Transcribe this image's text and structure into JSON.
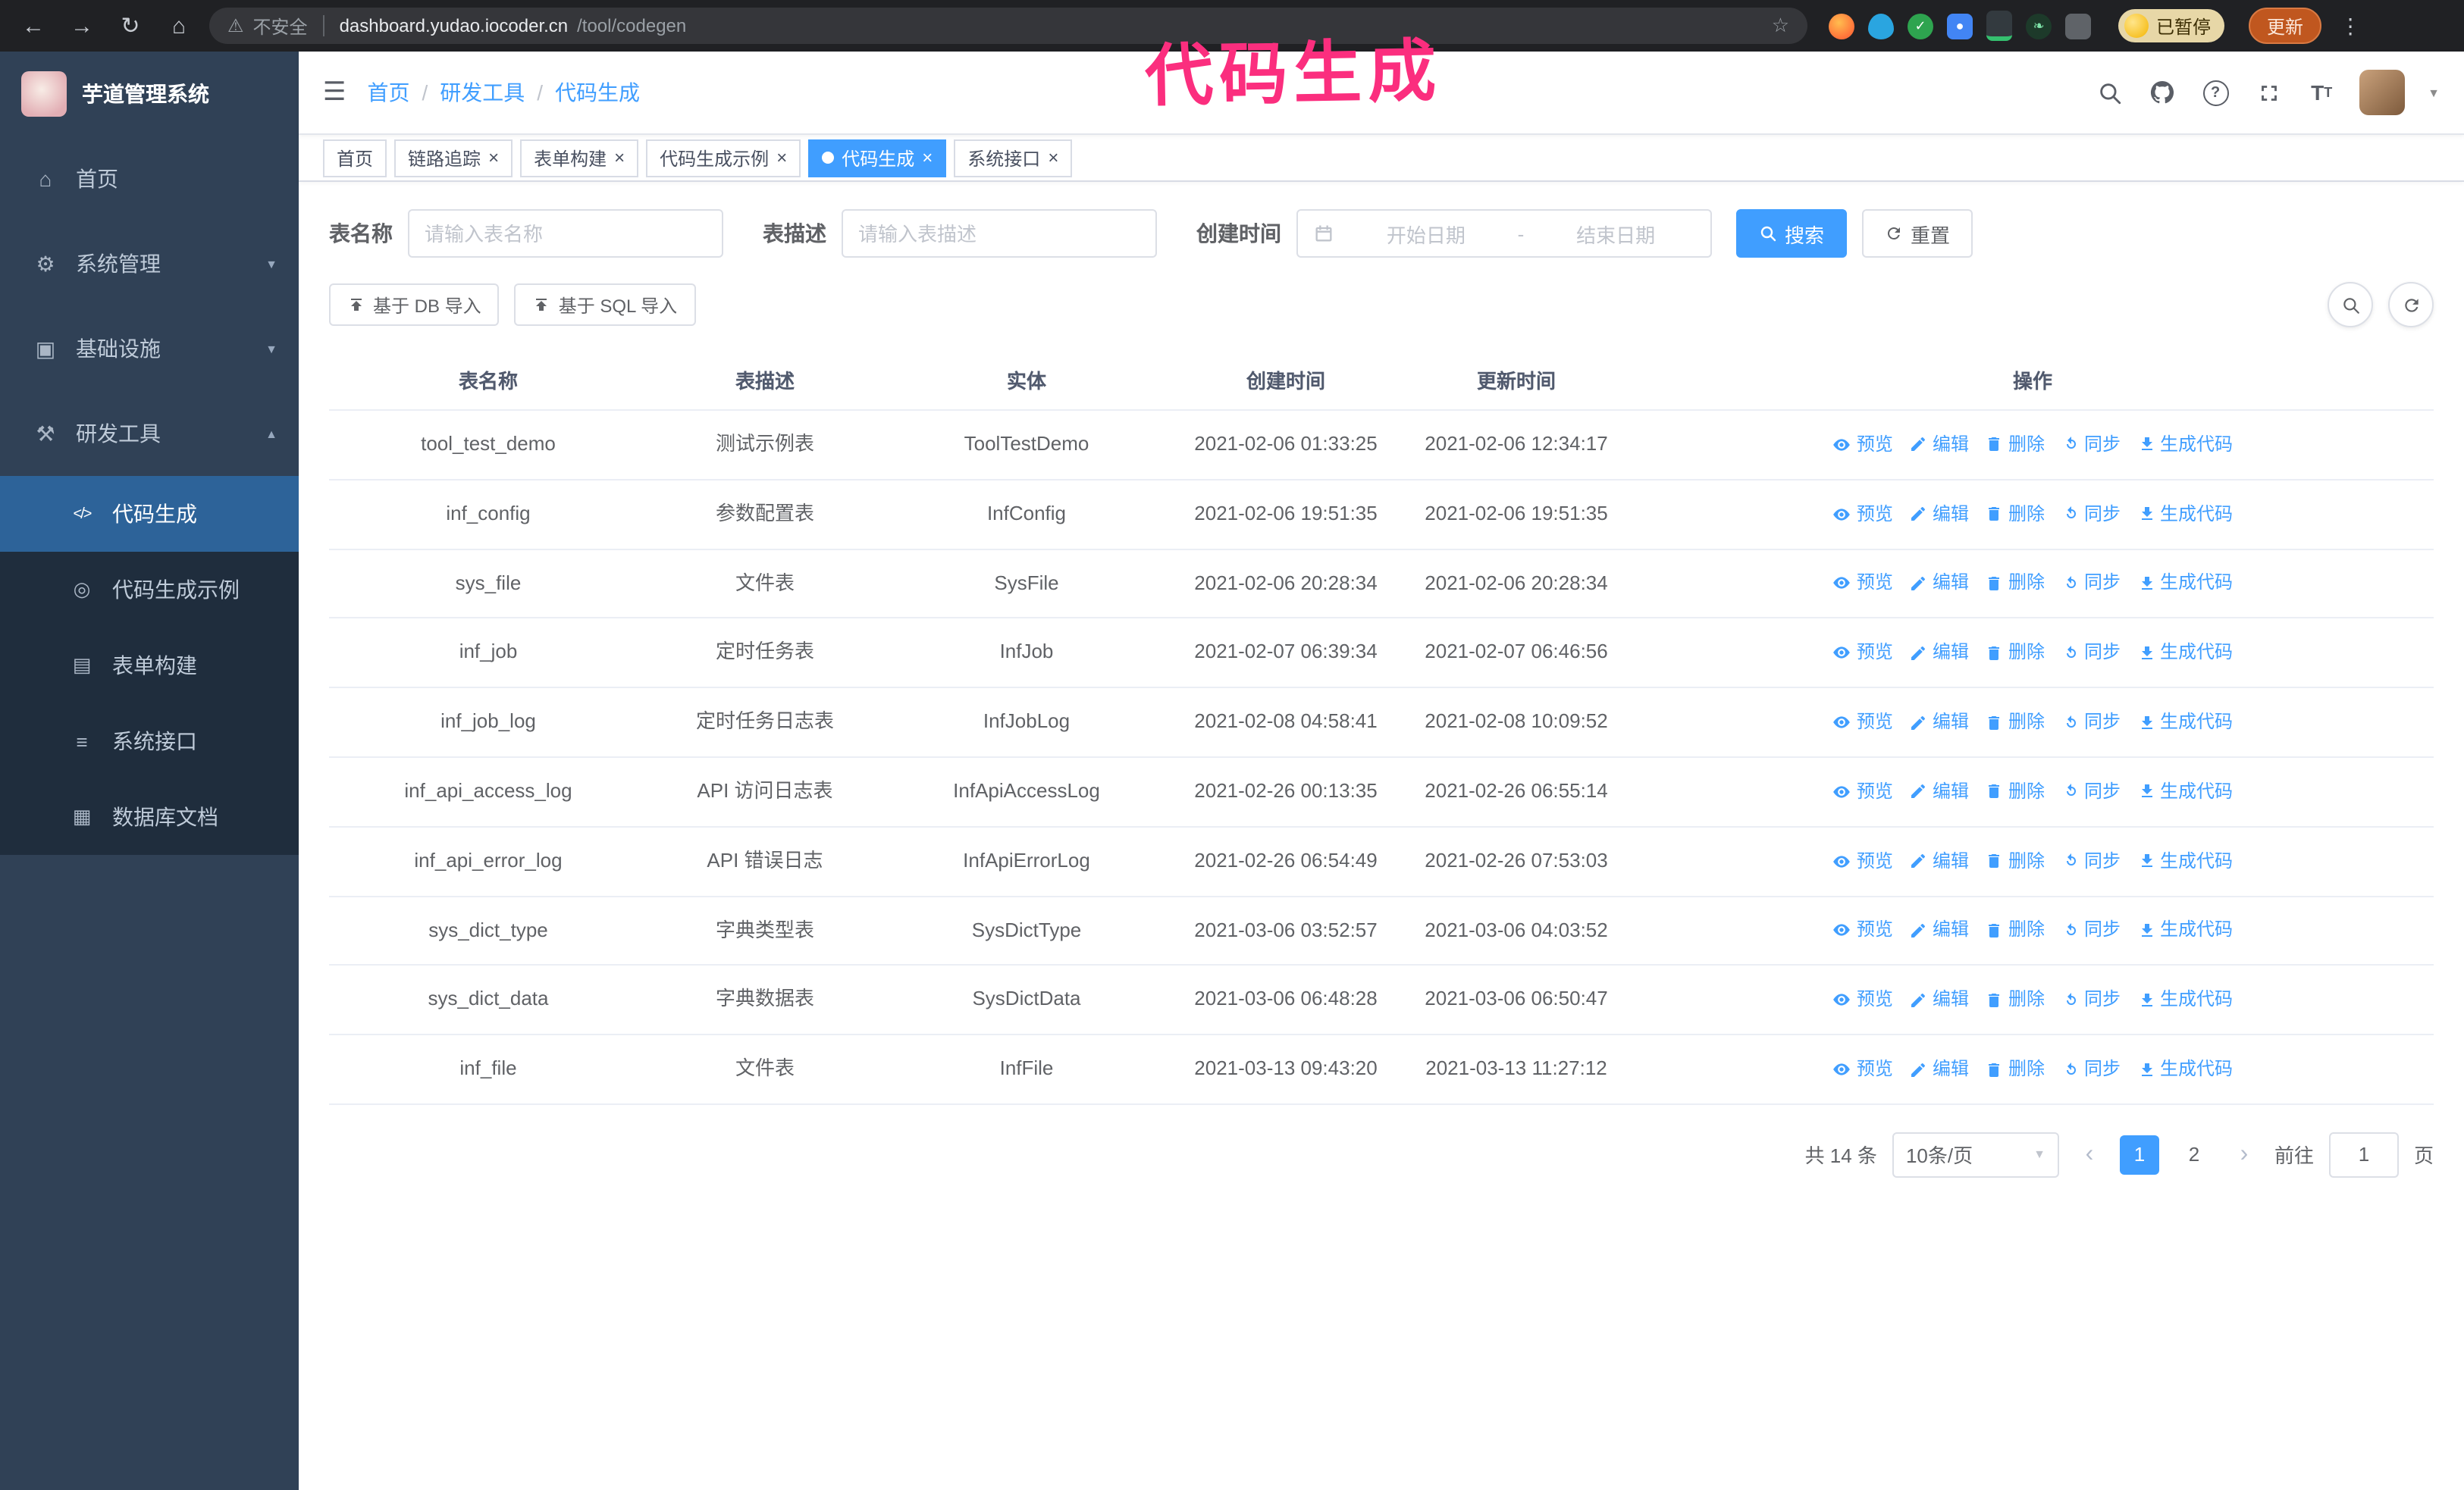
{
  "browser": {
    "security_label": "不安全",
    "url_host": "dashboard.yudao.iocoder.cn",
    "url_path": "/tool/codegen",
    "paused_badge": "已暂停",
    "update_button": "更新"
  },
  "annotation": {
    "text": "代码生成",
    "color": "#fb2e7e"
  },
  "sidebar": {
    "logo_title": "芋道管理系统",
    "items": [
      {
        "label": "首页",
        "icon": "home-icon"
      },
      {
        "label": "系统管理",
        "icon": "gear-icon"
      },
      {
        "label": "基础设施",
        "icon": "infrastructure-icon"
      },
      {
        "label": "研发工具",
        "icon": "tools-icon"
      }
    ],
    "submenu": [
      {
        "label": "代码生成",
        "icon": "code-icon",
        "active": true
      },
      {
        "label": "代码生成示例",
        "icon": "example-icon"
      },
      {
        "label": "表单构建",
        "icon": "form-icon"
      },
      {
        "label": "系统接口",
        "icon": "api-icon"
      },
      {
        "label": "数据库文档",
        "icon": "db-doc-icon"
      }
    ]
  },
  "header": {
    "breadcrumb": [
      "首页",
      "研发工具",
      "代码生成"
    ]
  },
  "tabs": [
    {
      "label": "首页",
      "closable": false
    },
    {
      "label": "链路追踪",
      "closable": true
    },
    {
      "label": "表单构建",
      "closable": true
    },
    {
      "label": "代码生成示例",
      "closable": true
    },
    {
      "label": "代码生成",
      "closable": true,
      "active": true
    },
    {
      "label": "系统接口",
      "closable": true
    }
  ],
  "filters": {
    "table_name_label": "表名称",
    "table_name_placeholder": "请输入表名称",
    "table_desc_label": "表描述",
    "table_desc_placeholder": "请输入表描述",
    "create_time_label": "创建时间",
    "date_start_placeholder": "开始日期",
    "date_separator": "-",
    "date_end_placeholder": "结束日期",
    "search_button": "搜索",
    "reset_button": "重置"
  },
  "toolbar": {
    "import_db_button": "基于 DB 导入",
    "import_sql_button": "基于 SQL 导入"
  },
  "table": {
    "columns": [
      "表名称",
      "表描述",
      "实体",
      "创建时间",
      "更新时间",
      "操作"
    ],
    "actions": [
      "预览",
      "编辑",
      "删除",
      "同步",
      "生成代码"
    ],
    "rows": [
      {
        "name": "tool_test_demo",
        "desc": "测试示例表",
        "entity": "ToolTestDemo",
        "created": "2021-02-06 01:33:25",
        "updated": "2021-02-06 12:34:17"
      },
      {
        "name": "inf_config",
        "desc": "参数配置表",
        "entity": "InfConfig",
        "created": "2021-02-06 19:51:35",
        "updated": "2021-02-06 19:51:35"
      },
      {
        "name": "sys_file",
        "desc": "文件表",
        "entity": "SysFile",
        "created": "2021-02-06 20:28:34",
        "updated": "2021-02-06 20:28:34"
      },
      {
        "name": "inf_job",
        "desc": "定时任务表",
        "entity": "InfJob",
        "created": "2021-02-07 06:39:34",
        "updated": "2021-02-07 06:46:56"
      },
      {
        "name": "inf_job_log",
        "desc": "定时任务日志表",
        "entity": "InfJobLog",
        "created": "2021-02-08 04:58:41",
        "updated": "2021-02-08 10:09:52"
      },
      {
        "name": "inf_api_access_log",
        "desc": "API 访问日志表",
        "entity": "InfApiAccessLog",
        "created": "2021-02-26 00:13:35",
        "updated": "2021-02-26 06:55:14"
      },
      {
        "name": "inf_api_error_log",
        "desc": "API 错误日志",
        "entity": "InfApiErrorLog",
        "created": "2021-02-26 06:54:49",
        "updated": "2021-02-26 07:53:03"
      },
      {
        "name": "sys_dict_type",
        "desc": "字典类型表",
        "entity": "SysDictType",
        "created": "2021-03-06 03:52:57",
        "updated": "2021-03-06 04:03:52"
      },
      {
        "name": "sys_dict_data",
        "desc": "字典数据表",
        "entity": "SysDictData",
        "created": "2021-03-06 06:48:28",
        "updated": "2021-03-06 06:50:47"
      },
      {
        "name": "inf_file",
        "desc": "文件表",
        "entity": "InfFile",
        "created": "2021-03-13 09:43:20",
        "updated": "2021-03-13 11:27:12"
      }
    ]
  },
  "pagination": {
    "total": "共 14 条",
    "page_size": "10条/页",
    "pages": [
      {
        "label": "1",
        "active": true
      },
      {
        "label": "2",
        "active": false
      }
    ],
    "goto_label": "前往",
    "goto_value": "1",
    "goto_suffix": "页"
  },
  "colors": {
    "primary": "#409EFF",
    "sidebar_bg": "#304156",
    "submenu_bg": "#1f2d3d",
    "active_menu_bg": "#2d6399",
    "annotation_pink": "#fb2e7e",
    "chrome_bg": "#202124"
  }
}
